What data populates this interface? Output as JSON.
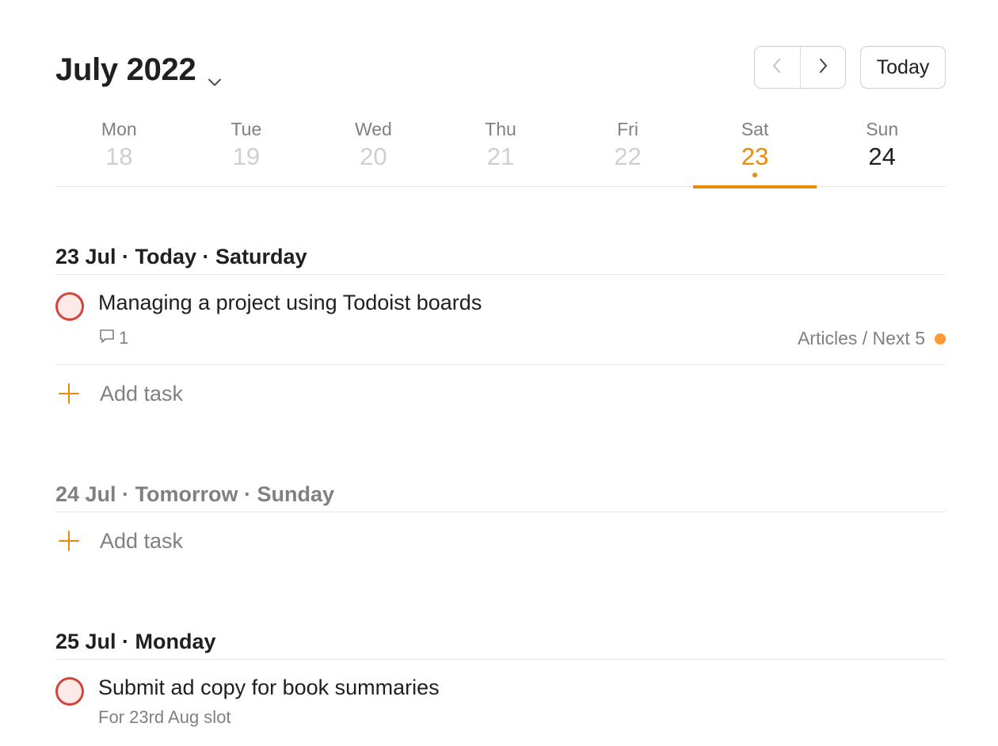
{
  "header": {
    "month_title": "July 2022",
    "today_label": "Today"
  },
  "week": {
    "days": [
      {
        "name": "Mon",
        "num": "18"
      },
      {
        "name": "Tue",
        "num": "19"
      },
      {
        "name": "Wed",
        "num": "20"
      },
      {
        "name": "Thu",
        "num": "21"
      },
      {
        "name": "Fri",
        "num": "22"
      },
      {
        "name": "Sat",
        "num": "23"
      },
      {
        "name": "Sun",
        "num": "24"
      }
    ],
    "selected_index": 5
  },
  "sections": [
    {
      "heading": "23 Jul · Today · Saturday",
      "tasks": [
        {
          "title": "Managing a project using Todoist boards",
          "comments": "1",
          "project": "Articles / Next 5"
        }
      ],
      "add_label": "Add task"
    },
    {
      "heading": "24 Jul · Tomorrow · Sunday",
      "add_label": "Add task"
    },
    {
      "heading": "25 Jul · Monday",
      "tasks": [
        {
          "title": "Submit ad copy for book summaries",
          "description": "For 23rd Aug slot"
        }
      ]
    }
  ],
  "colors": {
    "accent": "#eb8909",
    "priority_red": "#d1453b",
    "project_dot": "#ff9a33"
  },
  "icons": {
    "month_dropdown": "chevron-down-icon",
    "prev": "chevron-left-icon",
    "next": "chevron-right-icon",
    "comment": "comment-icon",
    "add": "plus-icon"
  }
}
